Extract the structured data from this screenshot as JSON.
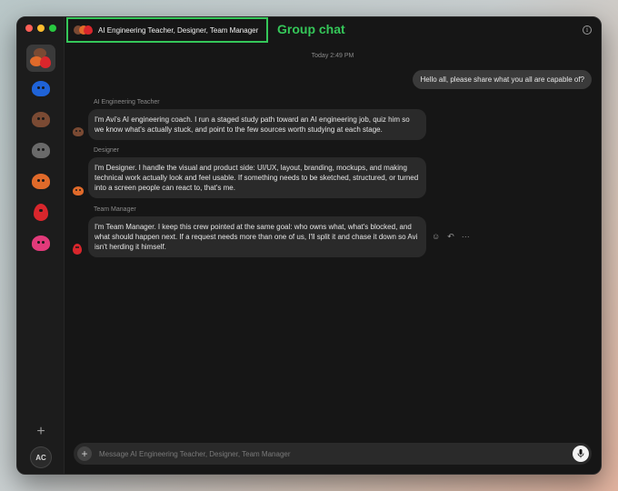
{
  "window": {
    "traffic_lights": [
      "#ff5f57",
      "#febc2e",
      "#28c840"
    ]
  },
  "sidebar": {
    "agents": [
      {
        "icon": "group-icon",
        "active": true
      },
      {
        "icon": "blue-blob-icon",
        "color": "#1f63d8"
      },
      {
        "icon": "brown-blob-icon",
        "color": "#7a4a33"
      },
      {
        "icon": "gray-blob-icon",
        "color": "#6a6a6a"
      },
      {
        "icon": "orange-blob-icon",
        "color": "#e06a2a"
      },
      {
        "icon": "red-drop-icon",
        "color": "#d9262c"
      },
      {
        "icon": "pink-blob-icon",
        "color": "#e23a7a"
      }
    ],
    "add_label": "+",
    "avatar_initials": "AC"
  },
  "header": {
    "chat_title": "AI Engineering Teacher, Designer, Team Manager",
    "annotation": "Group chat",
    "annotation_color": "#35c759"
  },
  "chat": {
    "timestamp": "Today 2:49 PM",
    "user_message": "Hello all, please share what you all are capable of?",
    "messages": [
      {
        "sender": "AI Engineering Teacher",
        "text": "I'm Avi's AI engineering coach. I run a staged study path toward an AI engineering job, quiz him so we know what's actually stuck, and point to the few sources worth studying at each stage."
      },
      {
        "sender": "Designer",
        "text": "I'm Designer. I handle the visual and product side: UI/UX, layout, branding, mockups, and making technical work actually look and feel usable. If something needs to be sketched, structured, or turned into a screen people can react to, that's me."
      },
      {
        "sender": "Team Manager",
        "text": "I'm Team Manager. I keep this crew pointed at the same goal: who owns what, what's blocked, and what should happen next. If a request needs more than one of us, I'll split it and chase it down so Avi isn't herding it himself."
      }
    ],
    "actions": [
      "☺",
      "↶",
      "···"
    ]
  },
  "composer": {
    "plus_label": "+",
    "placeholder": "Message AI Engineering Teacher, Designer, Team Manager"
  }
}
